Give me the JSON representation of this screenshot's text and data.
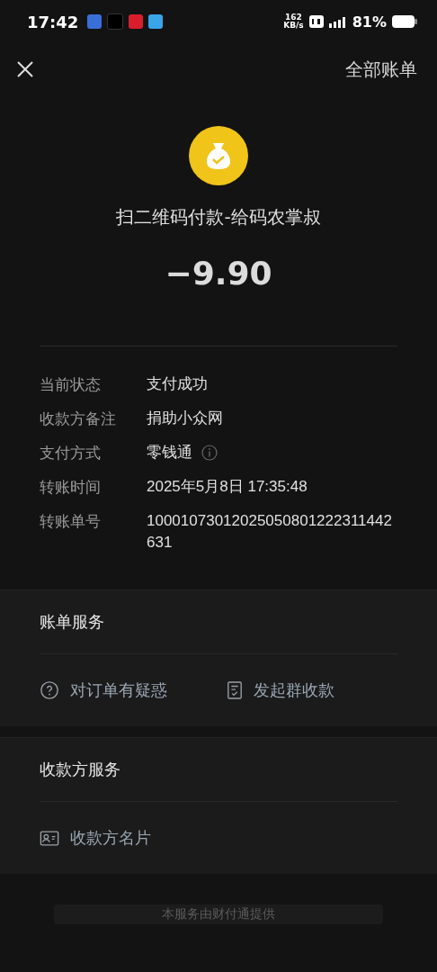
{
  "status_bar": {
    "time": "17:42",
    "speed_value": "162",
    "speed_unit": "KB/s",
    "battery": "81%"
  },
  "header": {
    "all_bills": "全部账单"
  },
  "payment": {
    "title": "扫二维码付款-给码农掌叔",
    "amount": "−9.90"
  },
  "details": [
    {
      "label": "当前状态",
      "value": "支付成功",
      "info": false
    },
    {
      "label": "收款方备注",
      "value": "捐助小众网",
      "info": false
    },
    {
      "label": "支付方式",
      "value": "零钱通",
      "info": true
    },
    {
      "label": "转账时间",
      "value": "2025年5月8日 17:35:48",
      "info": false
    },
    {
      "label": "转账单号",
      "value": "10001073012025050801222311442631",
      "info": false
    }
  ],
  "bill_services": {
    "title": "账单服务",
    "actions": [
      {
        "kind": "question",
        "label": "对订单有疑惑"
      },
      {
        "kind": "receipt",
        "label": "发起群收款"
      }
    ]
  },
  "payee_services": {
    "title": "收款方服务",
    "actions": [
      {
        "kind": "card",
        "label": "收款方名片"
      }
    ]
  },
  "footer": {
    "note": "本服务由财付通提供"
  }
}
